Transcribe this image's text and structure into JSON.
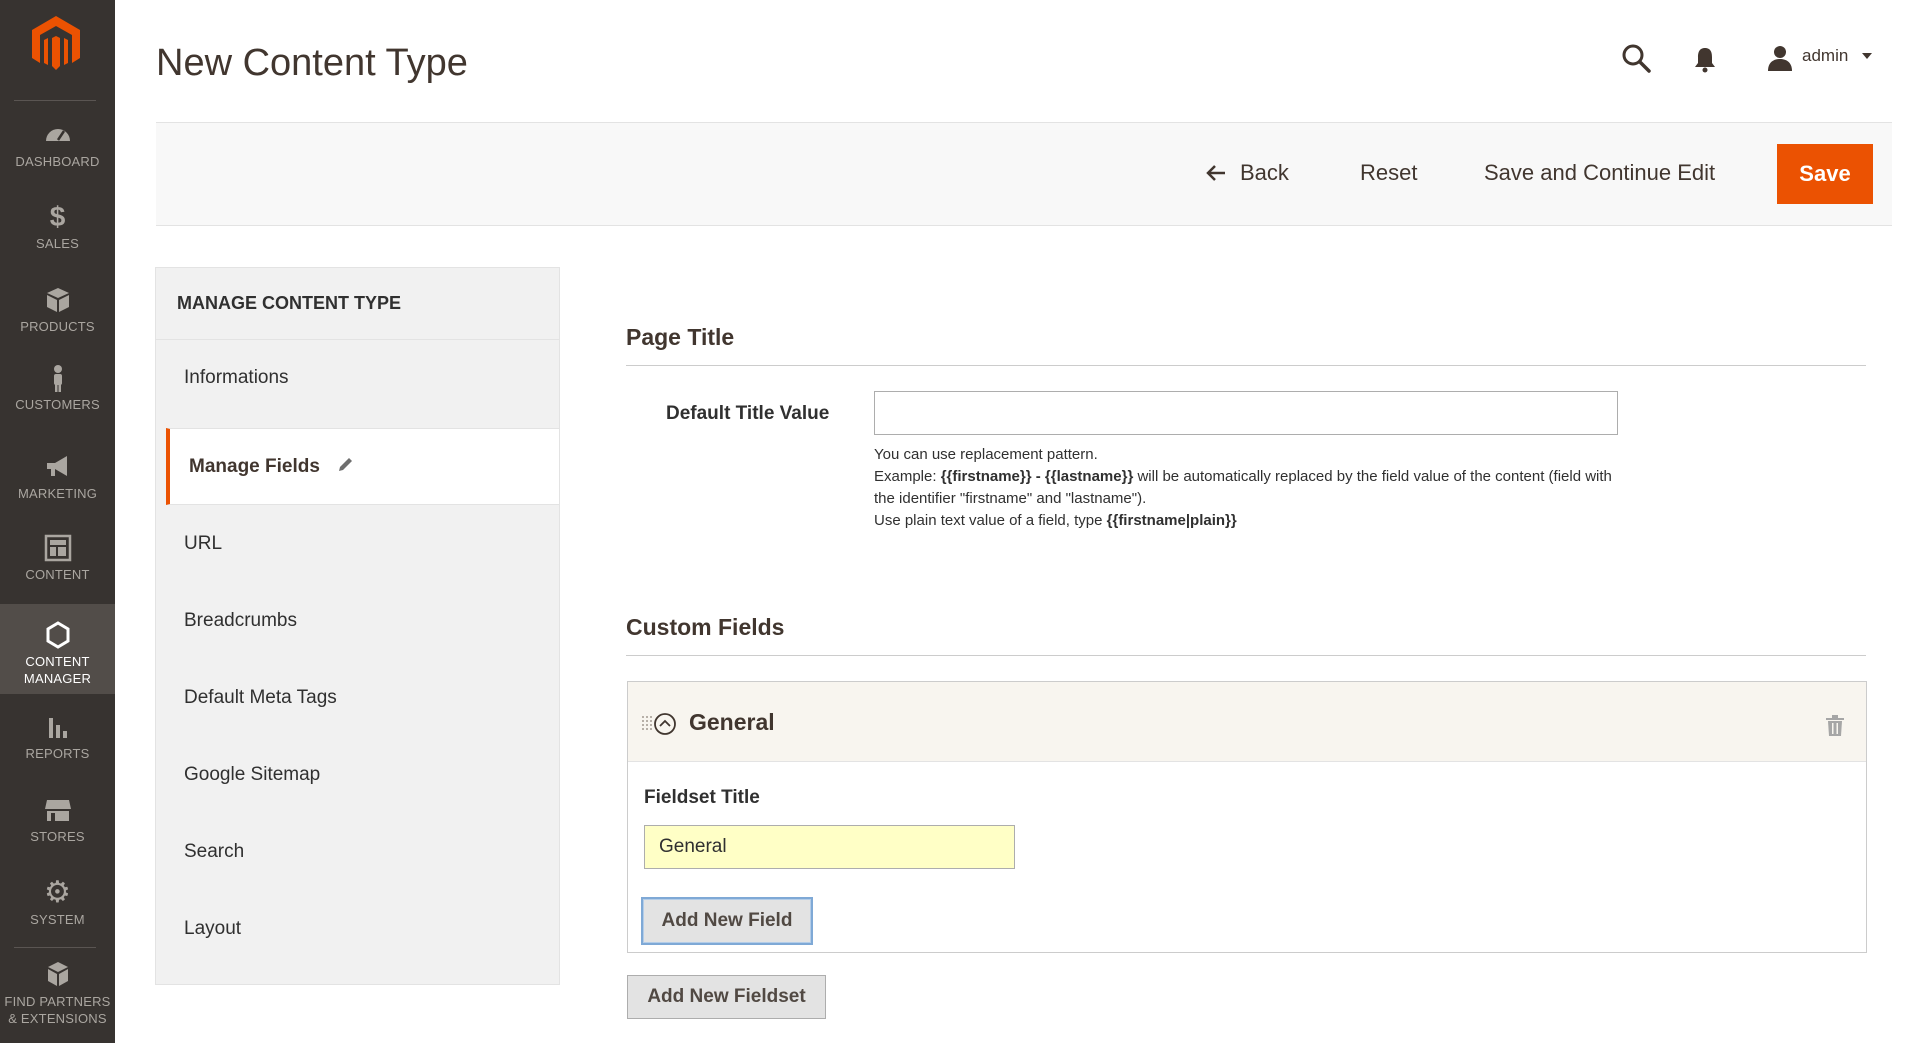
{
  "app": {
    "brand_color": "#eb5202",
    "sidebar_bg": "#373330"
  },
  "sidebar": {
    "logo_icon": "magento-logo-icon",
    "items": [
      {
        "label": "DASHBOARD",
        "icon": "dashboard-gauge-icon",
        "active": false
      },
      {
        "label": "SALES",
        "icon": "dollar-icon",
        "active": false
      },
      {
        "label": "PRODUCTS",
        "icon": "cube-icon",
        "active": false
      },
      {
        "label": "CUSTOMERS",
        "icon": "person-icon",
        "active": false
      },
      {
        "label": "MARKETING",
        "icon": "megaphone-icon",
        "active": false
      },
      {
        "label": "CONTENT",
        "icon": "layout-icon",
        "active": false
      },
      {
        "label": "CONTENT MANAGER",
        "icon": "hexagon-icon",
        "active": true
      },
      {
        "label": "REPORTS",
        "icon": "bar-chart-icon",
        "active": false
      },
      {
        "label": "STORES",
        "icon": "storefront-icon",
        "active": false
      },
      {
        "label": "SYSTEM",
        "icon": "gear-icon",
        "active": false
      },
      {
        "label": "FIND PARTNERS & EXTENSIONS",
        "icon": "boxes-icon",
        "active": false
      }
    ]
  },
  "header": {
    "title": "New Content Type",
    "user": "admin",
    "search_icon": "search-icon",
    "notifications_icon": "bell-icon",
    "user_icon": "user-icon"
  },
  "actions": {
    "back": "Back",
    "reset": "Reset",
    "save_continue": "Save and Continue Edit",
    "save": "Save"
  },
  "tabs": {
    "heading": "MANAGE CONTENT TYPE",
    "items": [
      {
        "label": "Informations"
      },
      {
        "label": "Manage Fields"
      },
      {
        "label": "URL"
      },
      {
        "label": "Breadcrumbs"
      },
      {
        "label": "Default Meta Tags"
      },
      {
        "label": "Google Sitemap"
      },
      {
        "label": "Search"
      },
      {
        "label": "Layout"
      }
    ],
    "active_index": 1
  },
  "page_title_section": {
    "heading": "Page Title",
    "field_label": "Default Title Value",
    "field_value": "",
    "note": {
      "line1": "You can use replacement pattern.",
      "line2_prefix": "Example: ",
      "line2_bold": "{{firstname}} - {{lastname}}",
      "line2_suffix": " will be automatically replaced by the field value of the content (field with the identifier \"firstname\" and \"lastname\").",
      "line3_prefix": "Use plain text value of a field, type ",
      "line3_bold": "{{firstname|plain}}"
    }
  },
  "custom_fields": {
    "heading": "Custom Fields",
    "fieldset": {
      "name": "General",
      "title_label": "Fieldset Title",
      "title_value": "General",
      "add_field": "Add New Field"
    },
    "add_fieldset": "Add New Fieldset"
  }
}
